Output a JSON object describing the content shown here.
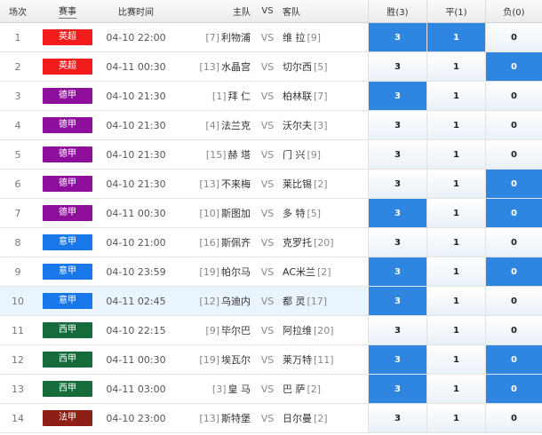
{
  "header": {
    "no": "场次",
    "league": "赛事",
    "time": "比赛时间",
    "home": "主队",
    "vs": "VS",
    "away": "客队",
    "win": "胜(3)",
    "draw": "平(1)",
    "lose": "负(0)"
  },
  "colors": {
    "premier_league": "#f21c1c",
    "bundesliga": "#8e0f9c",
    "serie_a": "#1878ea",
    "la_liga": "#166b3c",
    "ligue_1": "#8e1f17",
    "selected": "#2f86e0",
    "highlight_row": "#eaf4fc"
  },
  "rows": [
    {
      "no": "1",
      "league": "英超",
      "color": "#f21c1c",
      "time": "04-10 22:00",
      "home_rank": "[7]",
      "home": "利物浦",
      "vs": "VS",
      "away": "维 拉",
      "away_rank": "[9]",
      "win": "3",
      "draw": "1",
      "lose": "0",
      "sel": [
        true,
        true,
        false
      ]
    },
    {
      "no": "2",
      "league": "英超",
      "color": "#f21c1c",
      "time": "04-11 00:30",
      "home_rank": "[13]",
      "home": "水晶宫",
      "vs": "VS",
      "away": "切尔西",
      "away_rank": "[5]",
      "win": "3",
      "draw": "1",
      "lose": "0",
      "sel": [
        false,
        false,
        true
      ]
    },
    {
      "no": "3",
      "league": "德甲",
      "color": "#8e0f9c",
      "time": "04-10 21:30",
      "home_rank": "[1]",
      "home": "拜 仁",
      "vs": "VS",
      "away": "柏林联",
      "away_rank": "[7]",
      "win": "3",
      "draw": "1",
      "lose": "0",
      "sel": [
        true,
        false,
        false
      ]
    },
    {
      "no": "4",
      "league": "德甲",
      "color": "#8e0f9c",
      "time": "04-10 21:30",
      "home_rank": "[4]",
      "home": "法兰克",
      "vs": "VS",
      "away": "沃尔夫",
      "away_rank": "[3]",
      "win": "3",
      "draw": "1",
      "lose": "0",
      "sel": [
        false,
        false,
        false
      ]
    },
    {
      "no": "5",
      "league": "德甲",
      "color": "#8e0f9c",
      "time": "04-10 21:30",
      "home_rank": "[15]",
      "home": "赫 塔",
      "vs": "VS",
      "away": "门 兴",
      "away_rank": "[9]",
      "win": "3",
      "draw": "1",
      "lose": "0",
      "sel": [
        false,
        false,
        false
      ]
    },
    {
      "no": "6",
      "league": "德甲",
      "color": "#8e0f9c",
      "time": "04-10 21:30",
      "home_rank": "[13]",
      "home": "不来梅",
      "vs": "VS",
      "away": "莱比锡",
      "away_rank": "[2]",
      "win": "3",
      "draw": "1",
      "lose": "0",
      "sel": [
        false,
        false,
        true
      ]
    },
    {
      "no": "7",
      "league": "德甲",
      "color": "#8e0f9c",
      "time": "04-11 00:30",
      "home_rank": "[10]",
      "home": "斯图加",
      "vs": "VS",
      "away": "多 特",
      "away_rank": "[5]",
      "win": "3",
      "draw": "1",
      "lose": "0",
      "sel": [
        true,
        false,
        true
      ]
    },
    {
      "no": "8",
      "league": "意甲",
      "color": "#1878ea",
      "time": "04-10 21:00",
      "home_rank": "[16]",
      "home": "斯佩齐",
      "vs": "VS",
      "away": "克罗托",
      "away_rank": "[20]",
      "win": "3",
      "draw": "1",
      "lose": "0",
      "sel": [
        false,
        false,
        false
      ]
    },
    {
      "no": "9",
      "league": "意甲",
      "color": "#1878ea",
      "time": "04-10 23:59",
      "home_rank": "[19]",
      "home": "帕尔马",
      "vs": "VS",
      "away": "AC米兰",
      "away_rank": "[2]",
      "win": "3",
      "draw": "1",
      "lose": "0",
      "sel": [
        true,
        false,
        true
      ]
    },
    {
      "no": "10",
      "league": "意甲",
      "color": "#1878ea",
      "time": "04-11 02:45",
      "home_rank": "[12]",
      "home": "乌迪内",
      "vs": "VS",
      "away": "都 灵",
      "away_rank": "[17]",
      "win": "3",
      "draw": "1",
      "lose": "0",
      "sel": [
        true,
        false,
        false
      ],
      "highlight": true
    },
    {
      "no": "11",
      "league": "西甲",
      "color": "#166b3c",
      "time": "04-10 22:15",
      "home_rank": "[9]",
      "home": "毕尔巴",
      "vs": "VS",
      "away": "阿拉维",
      "away_rank": "[20]",
      "win": "3",
      "draw": "1",
      "lose": "0",
      "sel": [
        false,
        false,
        false
      ]
    },
    {
      "no": "12",
      "league": "西甲",
      "color": "#166b3c",
      "time": "04-11 00:30",
      "home_rank": "[19]",
      "home": "埃瓦尔",
      "vs": "VS",
      "away": "莱万特",
      "away_rank": "[11]",
      "win": "3",
      "draw": "1",
      "lose": "0",
      "sel": [
        true,
        false,
        true
      ]
    },
    {
      "no": "13",
      "league": "西甲",
      "color": "#166b3c",
      "time": "04-11 03:00",
      "home_rank": "[3]",
      "home": "皇 马",
      "vs": "VS",
      "away": "巴 萨",
      "away_rank": "[2]",
      "win": "3",
      "draw": "1",
      "lose": "0",
      "sel": [
        true,
        false,
        true
      ]
    },
    {
      "no": "14",
      "league": "法甲",
      "color": "#8e1f17",
      "time": "04-10 23:00",
      "home_rank": "[13]",
      "home": "斯特堡",
      "vs": "VS",
      "away": "日尔曼",
      "away_rank": "[2]",
      "win": "3",
      "draw": "1",
      "lose": "0",
      "sel": [
        false,
        false,
        false
      ]
    }
  ]
}
